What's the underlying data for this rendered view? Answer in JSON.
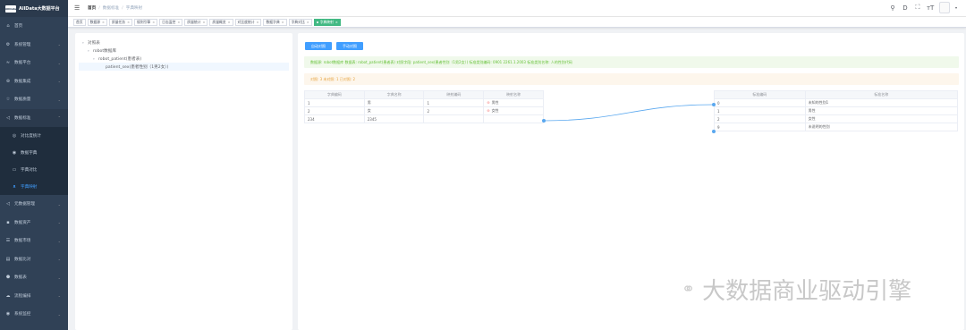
{
  "app": {
    "logo_mark": "AllData",
    "title": "AllData大数据平台"
  },
  "sidebar": {
    "items": [
      {
        "label": "首页",
        "icon": "home-icon",
        "glyph": "⌂"
      },
      {
        "label": "系统管理",
        "icon": "gear-icon",
        "glyph": "⚙"
      },
      {
        "label": "数据平台",
        "icon": "chart-icon",
        "glyph": "≈"
      },
      {
        "label": "数据集成",
        "icon": "integration-icon",
        "glyph": "⊛"
      },
      {
        "label": "数据质量",
        "icon": "quality-icon",
        "glyph": "☆"
      },
      {
        "label": "数据标准",
        "icon": "standard-icon",
        "glyph": "◁"
      }
    ],
    "sub_items": [
      {
        "label": "对比度统计",
        "icon": "stats-icon",
        "glyph": "◎"
      },
      {
        "label": "数据字典",
        "icon": "dictionary-icon",
        "glyph": "◉"
      },
      {
        "label": "字典对比",
        "icon": "compare-icon",
        "glyph": "▭"
      },
      {
        "label": "字典映射",
        "icon": "mapping-icon",
        "glyph": "ᴥ"
      }
    ],
    "items_after": [
      {
        "label": "元数据管理",
        "icon": "metadata-icon",
        "glyph": "◁"
      },
      {
        "label": "数据资产",
        "icon": "asset-icon",
        "glyph": "▪"
      },
      {
        "label": "数据市场",
        "icon": "market-icon",
        "glyph": "☰"
      },
      {
        "label": "数据比对",
        "icon": "contrast-icon",
        "glyph": "▤"
      },
      {
        "label": "数据表",
        "icon": "table-icon",
        "glyph": "⬣"
      },
      {
        "label": "流程编排",
        "icon": "flow-icon",
        "glyph": "☁"
      },
      {
        "label": "系统监控",
        "icon": "monitor-icon",
        "glyph": "◉"
      }
    ]
  },
  "header": {
    "breadcrumb": [
      "首页",
      "数据标准",
      "字典映射"
    ],
    "icons": [
      {
        "name": "search-icon",
        "glyph": "⚲"
      },
      {
        "name": "doc-icon",
        "glyph": "D"
      },
      {
        "name": "fullscreen-icon",
        "glyph": "⛶"
      },
      {
        "name": "font-size-icon",
        "glyph": "тT"
      }
    ],
    "caret": "▾"
  },
  "tags": [
    {
      "label": "首页",
      "closable": false
    },
    {
      "label": "数据源",
      "closable": true
    },
    {
      "label": "质量任务",
      "closable": true
    },
    {
      "label": "规则引擎",
      "closable": true
    },
    {
      "label": "日志监控",
      "closable": true
    },
    {
      "label": "质量统计",
      "closable": true
    },
    {
      "label": "质量概览",
      "closable": true
    },
    {
      "label": "对比度统计",
      "closable": true
    },
    {
      "label": "数据字典",
      "closable": true
    },
    {
      "label": "字典对比",
      "closable": true
    },
    {
      "label": "字典映射",
      "closable": true,
      "active": true
    }
  ],
  "tree": {
    "root": "对照表",
    "db": "robot数据库",
    "table": "robot_patient(患者表)",
    "field": "patient_sex(患者性别（1男2女）)"
  },
  "buttons": {
    "auto": "自动对照",
    "manual": "手动对照"
  },
  "alerts": {
    "success": "数据源: robot数据库 数据表: robot_patient(患者表) 对照字段: patient_sex(患者性别（1男2女）) 标准类别编码: 0901 2261.1.2003 标准类别名称: 人的性别代码",
    "warning": "对照: 3 未对照: 1 已对照: 2"
  },
  "left_table": {
    "headers": [
      "字典编码",
      "字典名称",
      "映射编码",
      "映射名称"
    ],
    "rows": [
      [
        "1",
        "男",
        "1",
        "男性"
      ],
      [
        "2",
        "女",
        "2",
        "女性"
      ],
      [
        "234",
        "2345",
        "",
        ""
      ]
    ],
    "remove_glyph": "⊖"
  },
  "right_table": {
    "headers": [
      "标准编码",
      "标准名称"
    ],
    "rows": [
      [
        "0",
        "未知的性别1"
      ],
      [
        "1",
        "男性"
      ],
      [
        "2",
        "女性"
      ],
      [
        "9",
        "未说明的性别"
      ]
    ]
  },
  "mapping_line": {
    "color": "#5aa8ef"
  },
  "watermark": {
    "icon": "wechat-icon",
    "glyph": "⚭",
    "text": "大数据商业驱动引擎"
  }
}
